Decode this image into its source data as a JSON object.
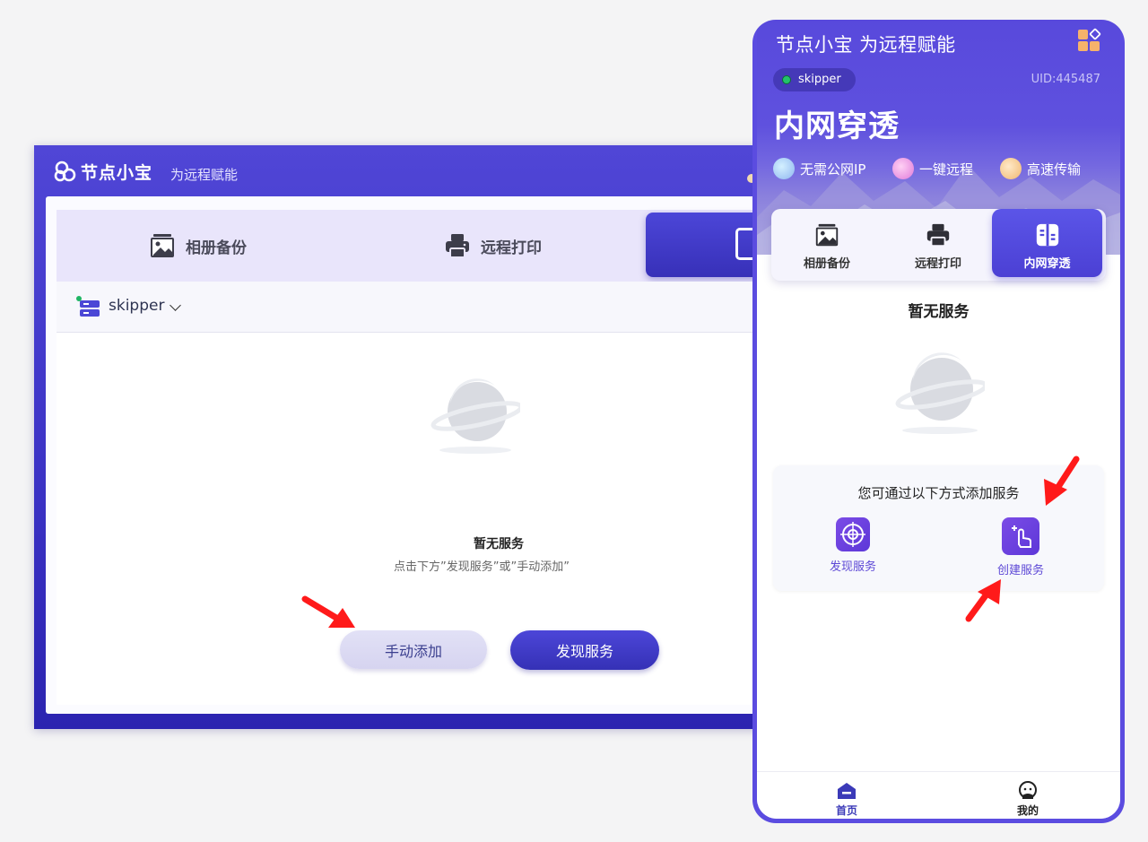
{
  "desktop": {
    "brand": "节点小宝",
    "slogan": "为远程赋能",
    "tabs": [
      {
        "label": "相册备份"
      },
      {
        "label": "远程打印"
      }
    ],
    "device_name": "skipper",
    "empty_title": "暂无服务",
    "empty_hint": "点击下方”发现服务”或”手动添加”",
    "btn_manual": "手动添加",
    "btn_discover": "发现服务",
    "colors": {
      "primary": "#3a31c4",
      "tab_bg": "#e9e5fb"
    }
  },
  "phone": {
    "title": "节点小宝 为远程赋能",
    "device_name": "skipper",
    "uid": "UID:445487",
    "big_title": "内网穿透",
    "features": [
      {
        "label": "无需公网IP",
        "icon": "globe-icon"
      },
      {
        "label": "一键远程",
        "icon": "monitor-icon"
      },
      {
        "label": "高速传输",
        "icon": "transfer-icon"
      }
    ],
    "tabs": [
      {
        "label": "相册备份"
      },
      {
        "label": "远程打印"
      },
      {
        "label": "内网穿透"
      }
    ],
    "empty_title": "暂无服务",
    "card_title": "您可通过以下方式添加服务",
    "card_discover": "发现服务",
    "card_create": "创建服务",
    "nav": [
      {
        "label": "首页"
      },
      {
        "label": "我的"
      }
    ],
    "colors": {
      "primary": "#5b4ce0",
      "accent": "#7b4ce6"
    }
  }
}
